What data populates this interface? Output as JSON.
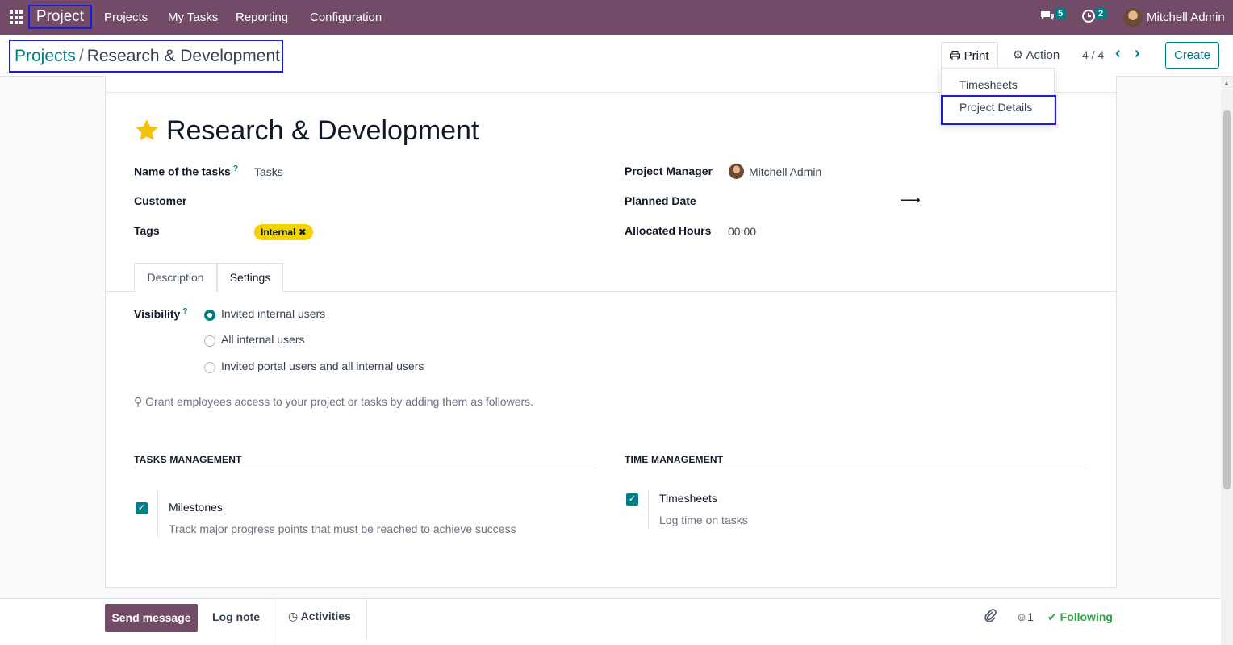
{
  "navbar": {
    "brand": "Project",
    "menu": [
      "Projects",
      "My Tasks",
      "Reporting",
      "Configuration"
    ],
    "messages_count": "5",
    "activities_count": "2",
    "user": "Mitchell Admin"
  },
  "control_panel": {
    "breadcrumb_parent": "Projects",
    "breadcrumb_separator": "/",
    "breadcrumb_current": "Research & Development",
    "print_label": "Print",
    "action_label": "Action",
    "pager": "4 / 4",
    "create_label": "Create"
  },
  "print_dropdown": {
    "items": [
      "Timesheets",
      "Project Details"
    ]
  },
  "form": {
    "title": "Research & Development",
    "name_of_tasks_label": "Name of the tasks",
    "name_of_tasks_value": "Tasks",
    "customer_label": "Customer",
    "tags_label": "Tags",
    "tag": "Internal",
    "project_manager_label": "Project Manager",
    "project_manager_value": "Mitchell Admin",
    "planned_date_label": "Planned Date",
    "allocated_hours_label": "Allocated Hours",
    "allocated_hours_value": "00:00",
    "help_mark": "?"
  },
  "tabs": [
    "Description",
    "Settings"
  ],
  "settings": {
    "visibility_label": "Visibility",
    "visibility_options": [
      "Invited internal users",
      "All internal users",
      "Invited portal users and all internal users"
    ],
    "visibility_selected_index": 0,
    "hint": "Grant employees access to your project or tasks by adding them as followers.",
    "tasks_management": {
      "title": "TASKS MANAGEMENT",
      "option_title": "Milestones",
      "option_desc": "Track major progress points that must be reached to achieve success",
      "checked": true
    },
    "time_management": {
      "title": "TIME MANAGEMENT",
      "option_title": "Timesheets",
      "option_desc": "Log time on tasks",
      "checked": true
    }
  },
  "chatter": {
    "send_message": "Send message",
    "log_note": "Log note",
    "activities": "Activities",
    "followers_count": "1",
    "following": "Following"
  },
  "colors": {
    "brand_purple": "#714b67",
    "accent_teal": "#017e84",
    "tag_yellow": "#f4d100",
    "highlight_blue": "#1a1ae6",
    "following_green": "#28a745"
  }
}
